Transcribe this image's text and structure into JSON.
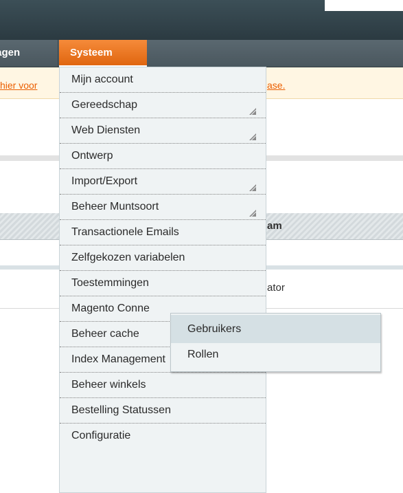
{
  "nav": {
    "prev_label": "lagen",
    "active_label": "Systeem"
  },
  "notice": {
    "left_link": " hier voor",
    "right_link": "ase."
  },
  "grid": {
    "header_fragment": "am",
    "row_fragment": "ator"
  },
  "dropdown": {
    "items": [
      {
        "label": "Mijn account",
        "has_submenu": false
      },
      {
        "label": "Gereedschap",
        "has_submenu": true
      },
      {
        "label": "Web Diensten",
        "has_submenu": true
      },
      {
        "label": "Ontwerp",
        "has_submenu": false
      },
      {
        "label": "Import/Export",
        "has_submenu": true
      },
      {
        "label": "Beheer Muntsoort",
        "has_submenu": true
      },
      {
        "label": "Transactionele Emails",
        "has_submenu": false
      },
      {
        "label": "Zelfgekozen variabelen",
        "has_submenu": false
      },
      {
        "label": "Toestemmingen",
        "has_submenu": false
      },
      {
        "label": "Magento Conne",
        "has_submenu": false
      },
      {
        "label": "Beheer cache",
        "has_submenu": false
      },
      {
        "label": "Index Management",
        "has_submenu": false
      },
      {
        "label": "Beheer winkels",
        "has_submenu": false
      },
      {
        "label": "Bestelling Statussen",
        "has_submenu": false
      },
      {
        "label": "Configuratie",
        "has_submenu": false
      }
    ]
  },
  "submenu": {
    "items": [
      {
        "label": "Gebruikers"
      },
      {
        "label": "Rollen"
      }
    ]
  },
  "colors": {
    "accent": "#e0660f",
    "nav_bg": "#4a575e",
    "link": "#eb5e00"
  }
}
